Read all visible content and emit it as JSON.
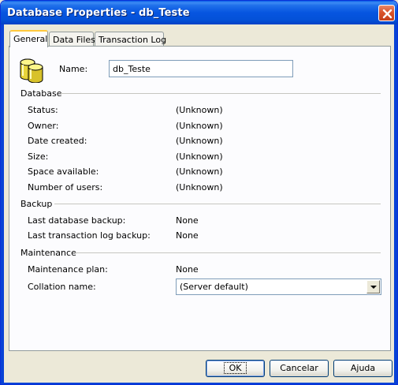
{
  "window": {
    "title": "Database Properties - db_Teste"
  },
  "tabs": [
    {
      "label": "General"
    },
    {
      "label": "Data Files"
    },
    {
      "label": "Transaction Log"
    }
  ],
  "general": {
    "name_label": "Name:",
    "name_value": "db_Teste",
    "database_group": "Database",
    "database_rows": [
      {
        "label": "Status:",
        "value": "(Unknown)"
      },
      {
        "label": "Owner:",
        "value": "(Unknown)"
      },
      {
        "label": "Date created:",
        "value": "(Unknown)"
      },
      {
        "label": "Size:",
        "value": "(Unknown)"
      },
      {
        "label": "Space available:",
        "value": "(Unknown)"
      },
      {
        "label": "Number of users:",
        "value": "(Unknown)"
      }
    ],
    "backup_group": "Backup",
    "backup_rows": [
      {
        "label": "Last database backup:",
        "value": "None"
      },
      {
        "label": "Last transaction log backup:",
        "value": "None"
      }
    ],
    "maintenance_group": "Maintenance",
    "maintenance_plan_label": "Maintenance plan:",
    "maintenance_plan_value": "None",
    "collation_label": "Collation name:",
    "collation_value": "(Server default)"
  },
  "buttons": {
    "ok": "OK",
    "cancel": "Cancelar",
    "help": "Ajuda"
  },
  "colors": {
    "titlebar": "#0655e0",
    "dialog_bg": "#ece9d8",
    "active_tab_highlight": "#ffc83c"
  }
}
